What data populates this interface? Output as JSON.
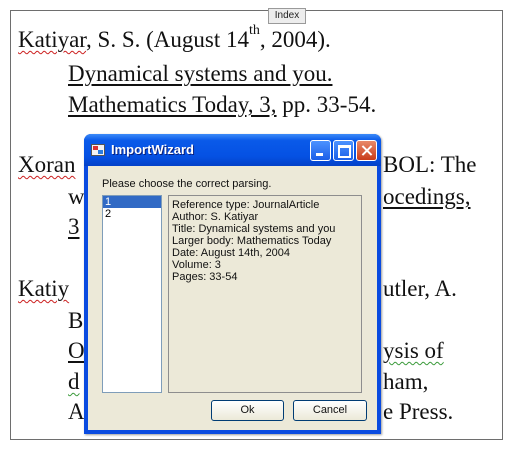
{
  "document": {
    "index_tag": "Index",
    "ref1_author": "Katiyar",
    "ref1_rest": ", S. S. (August 14",
    "ref1_sup": "th",
    "ref1_end": ", 2004).",
    "ref1_title": "Dynamical systems and you.",
    "ref1_journal": "Mathematics Today, 3,",
    "ref1_pages": " pp. 33-54.",
    "ref2_author": "Xoran",
    "ref2_right": "BOL:  The",
    "ref2_line2_left": "w",
    "ref2_line2_right": "ocedings,",
    "ref2_line3": "3",
    "ref3_author": "Katiy",
    "ref3_right": "utler, A.",
    "ref3_line2": "B",
    "ref3_line3_left": "O",
    "ref3_line3_right": "ysis of",
    "ref3_line4_left": "d",
    "ref3_line4_right": "ham,",
    "ref3_line5_left": "A",
    "ref3_line5_right": "e Press."
  },
  "dialog": {
    "title": "ImportWizard",
    "prompt": "Please choose the correct parsing.",
    "list_items": [
      "1",
      "2"
    ],
    "selected_index": 0,
    "details": [
      "Reference type:  JournalArticle",
      "Author:  S. Katiyar",
      "Title:  Dynamical systems and you",
      "Larger body:  Mathematics Today",
      "Date:  August 14th, 2004",
      "Volume:  3",
      "Pages:  33-54"
    ],
    "ok_label": "Ok",
    "cancel_label": "Cancel"
  }
}
